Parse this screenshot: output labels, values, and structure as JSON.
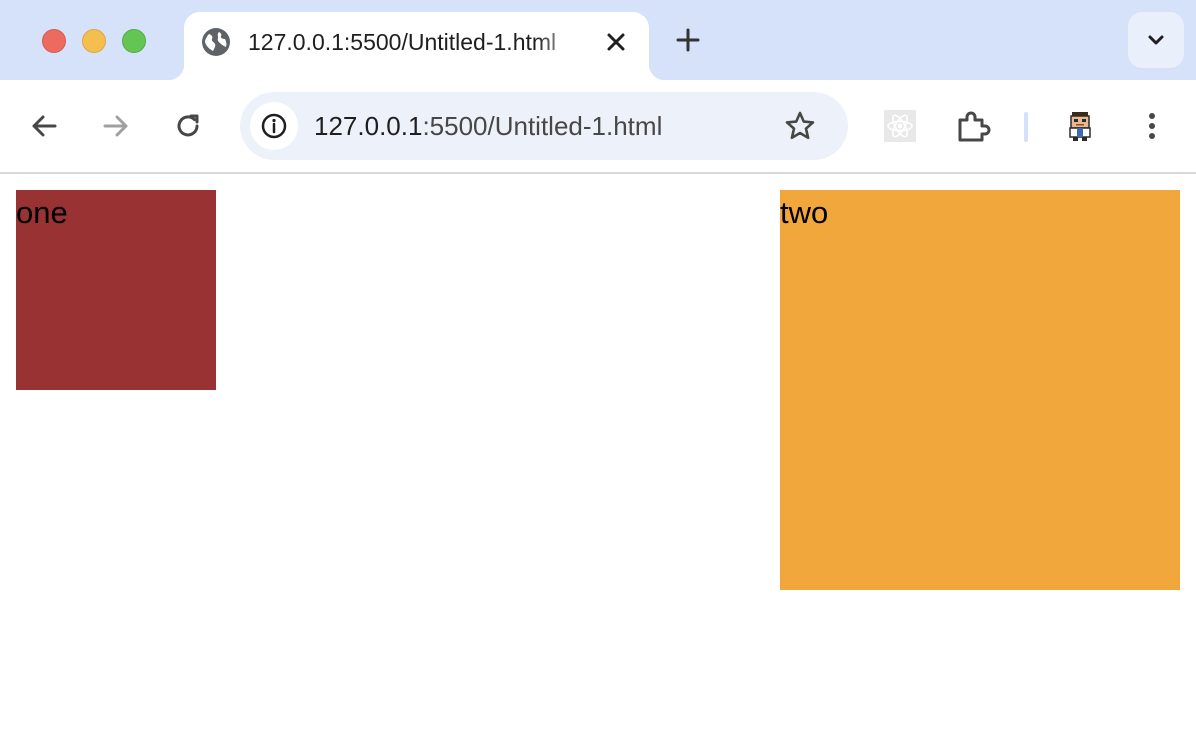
{
  "browser": {
    "tab": {
      "title": "127.0.0.1:5500/Untitled-1.html",
      "favicon": "globe-icon"
    },
    "address_bar": {
      "host": "127.0.0.1",
      "rest": ":5500/Untitled-1.html"
    },
    "icons": {
      "back": "arrow-left-icon",
      "forward": "arrow-right-icon",
      "reload": "reload-icon",
      "info": "info-icon",
      "bookmark": "star-icon",
      "react_devtools": "react-atom-icon",
      "extensions": "puzzle-icon",
      "profile": "avatar-icon",
      "menu": "more-vertical-icon",
      "tab_search": "chevron-down-icon",
      "new_tab": "plus-icon",
      "close_tab": "close-icon"
    },
    "colors": {
      "tabstrip": "#d6e2f9",
      "omnibox": "#edf2fa"
    }
  },
  "page": {
    "boxes": [
      {
        "label": "one",
        "color": "#993232"
      },
      {
        "label": "two",
        "color": "#f1a73b"
      }
    ]
  }
}
